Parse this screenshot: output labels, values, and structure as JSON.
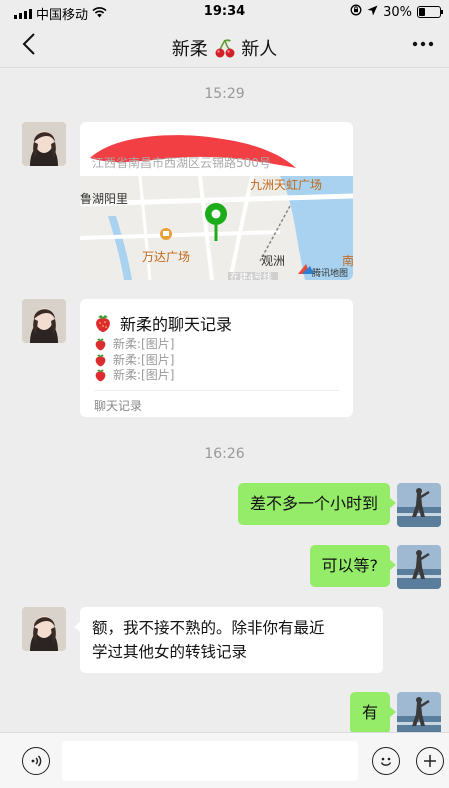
{
  "status_bar": {
    "carrier": "中国移动",
    "time": "19:34",
    "battery": "30%",
    "battery_level": 0.3
  },
  "nav": {
    "back_icon": "chevron-left-icon",
    "title_left": "新柔",
    "title_emoji": "cherries-icon",
    "title_right": "新人",
    "more_icon": "ellipsis-icon"
  },
  "chat": {
    "time_1": "15:29",
    "location": {
      "address": "江西省南昌市西湖区云锦路500号",
      "map_labels": {
        "l1": "九洲天虹广场",
        "l2": "鲁湖阳里",
        "l3": "万达广场",
        "l4": "观洲",
        "l5": "南",
        "l6": "在建4号线",
        "provider": "腾讯地图"
      }
    },
    "record": {
      "title": "新柔的聊天记录",
      "lines": [
        "新柔:[图片]",
        "新柔:[图片]",
        "新柔:[图片]"
      ],
      "footer": "聊天记录"
    },
    "time_2": "16:26",
    "messages": [
      {
        "text": "差不多一个小时到"
      },
      {
        "text": "可以等?"
      },
      {
        "text_line1": "额，我不接不熟的。除非你有最近",
        "text_line2": "学过其他女的转钱记录"
      },
      {
        "text": "有"
      }
    ]
  },
  "input_bar": {
    "voice_icon": "voice-icon",
    "emoji_icon": "emoji-icon",
    "add_icon": "plus-icon",
    "value": ""
  },
  "colors": {
    "bubble_green": "#95ec69",
    "map_pin": "#1aad19",
    "redaction": "#f0353a"
  }
}
